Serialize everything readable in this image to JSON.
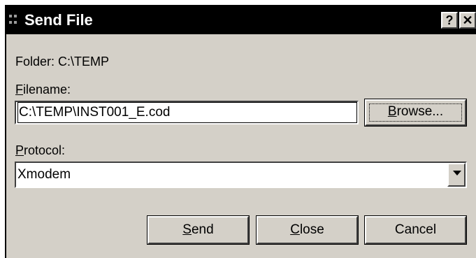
{
  "window": {
    "title": "Send File",
    "help_label": "?",
    "close_label": "✕"
  },
  "folder": {
    "text": "Folder:  C:\\TEMP"
  },
  "filename": {
    "label_underlined": "F",
    "label_rest": "ilename:",
    "value": "C:\\TEMP\\INST001_E.cod"
  },
  "browse": {
    "label_underlined": "B",
    "label_rest": "rowse..."
  },
  "protocol": {
    "label_underlined": "P",
    "label_rest": "rotocol:",
    "selected": "Xmodem"
  },
  "buttons": {
    "send_underlined": "S",
    "send_rest": "end",
    "close_underlined": "C",
    "close_rest": "lose",
    "cancel": "Cancel"
  }
}
